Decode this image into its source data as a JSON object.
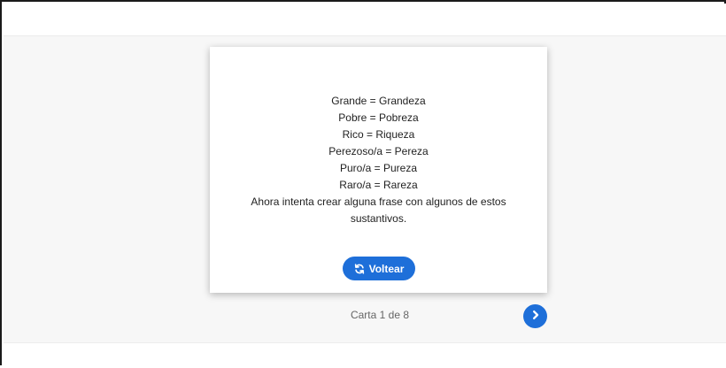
{
  "card": {
    "lines": [
      "Grande = Grandeza",
      "Pobre = Pobreza",
      "Rico = Riqueza",
      "Perezoso/a = Pereza",
      "Puro/a = Pureza",
      "Raro/a = Rareza",
      "Ahora intenta crear alguna frase con algunos de estos",
      "sustantivos."
    ],
    "flip_label": "Voltear",
    "flip_icon": "refresh-icon"
  },
  "navigation": {
    "counter": "Carta 1 de 8",
    "next_icon": "chevron-right-icon"
  },
  "colors": {
    "accent": "#1e6fd9",
    "stage_background": "#f7f7f7",
    "card_background": "#ffffff"
  }
}
